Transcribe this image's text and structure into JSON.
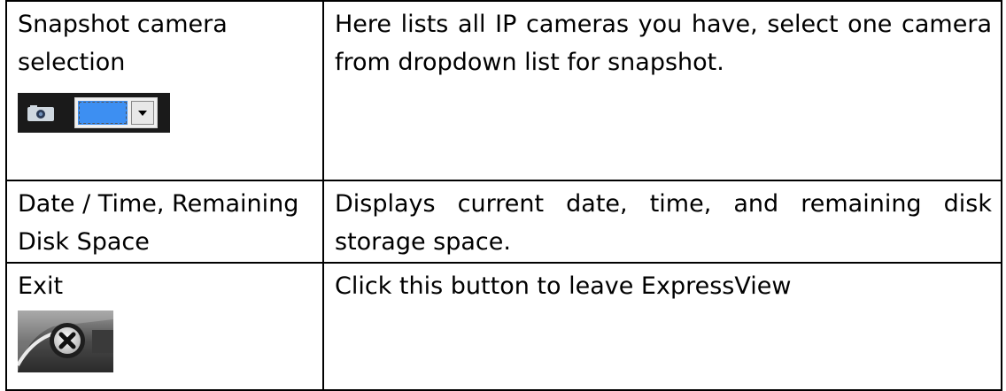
{
  "rows": [
    {
      "name": "Snapshot camera selection",
      "description": "Here lists all IP cameras you have, select one camera from dropdown list for snapshot.",
      "icon": "camera-dropdown-icon"
    },
    {
      "name": "Date / Time, Remaining Disk Space",
      "description": "Displays current date, time, and remaining disk storage space."
    },
    {
      "name": "Exit",
      "description": "Click this button to leave ExpressView",
      "icon": "exit-icon"
    }
  ],
  "colors": {
    "selector_swatch": "#3d8ff2",
    "selector_background": "#1a1a1a"
  }
}
